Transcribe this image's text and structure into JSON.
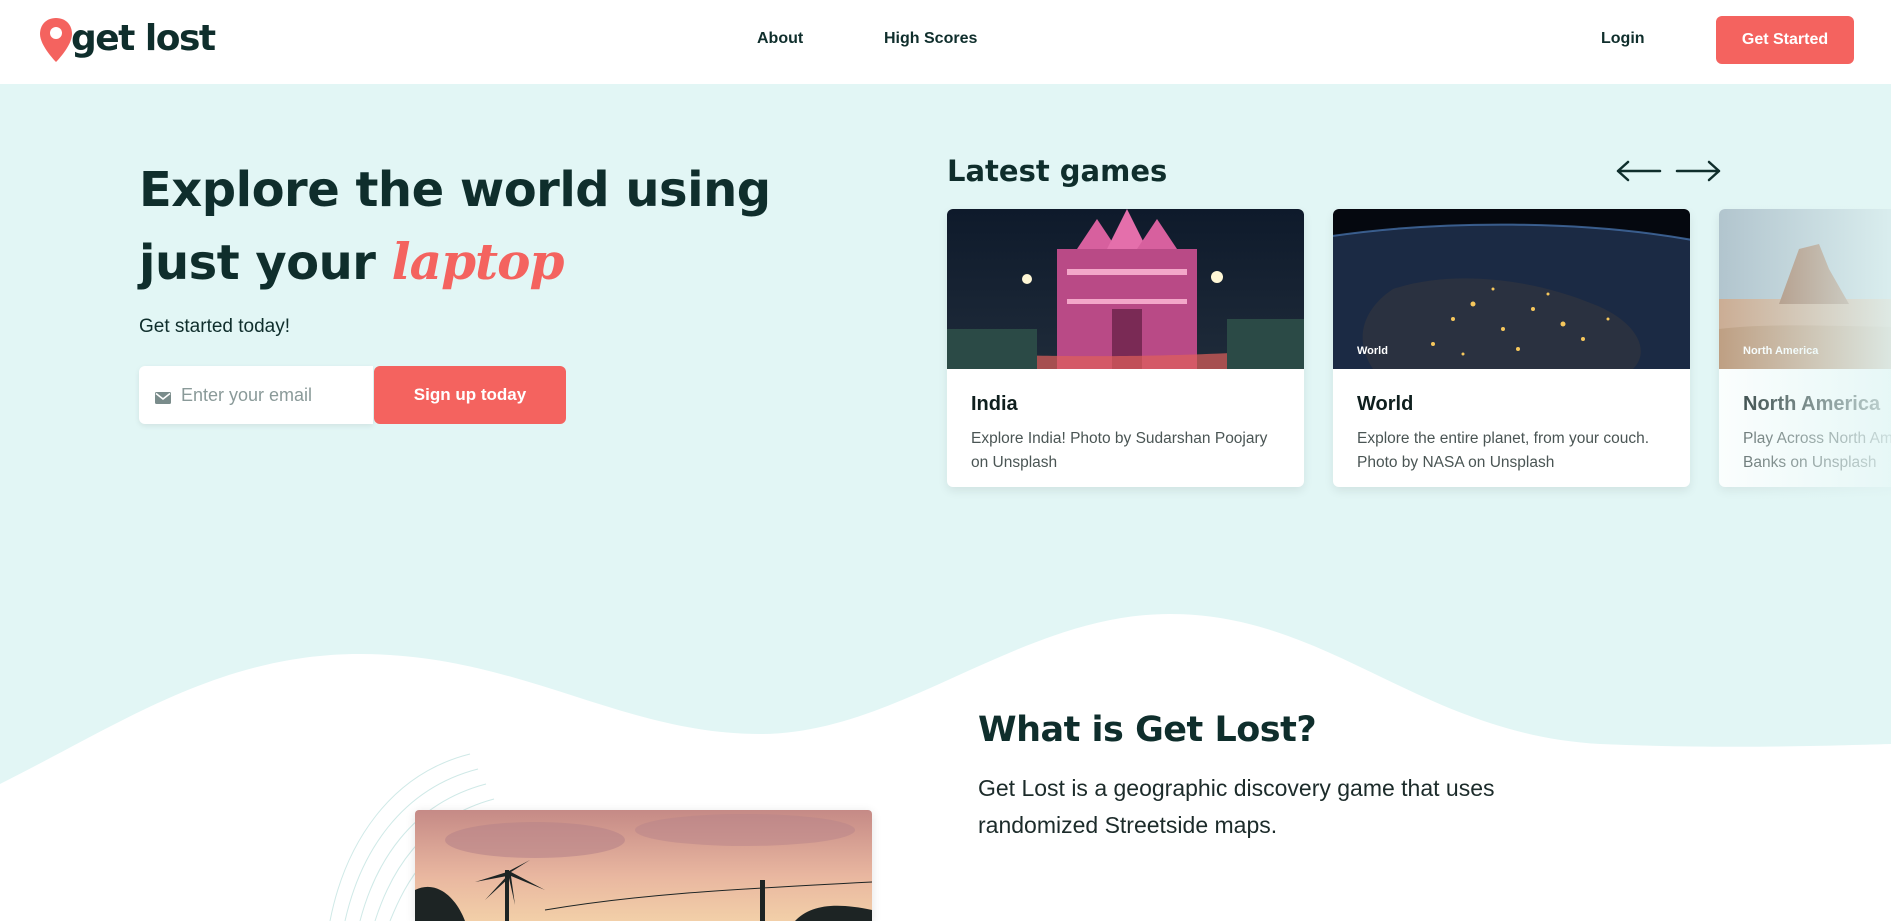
{
  "nav": {
    "logo_text": "get lost",
    "links": [
      {
        "label": "About"
      },
      {
        "label": "High Scores"
      }
    ],
    "login_label": "Login",
    "cta_label": "Get Started"
  },
  "hero": {
    "headline_main": "Explore the world using just your ",
    "headline_accent": "laptop",
    "subline": "Get started today!",
    "email_placeholder": "Enter your email",
    "signup_label": "Sign up today"
  },
  "latest": {
    "title": "Latest games",
    "games": [
      {
        "tag": "",
        "title": "India",
        "description": "Explore India! Photo by Sudarshan Poojary on Unsplash"
      },
      {
        "tag": "World",
        "title": "World",
        "description": "Explore the entire planet, from your couch. Photo by NASA on Unsplash"
      },
      {
        "tag": "North America",
        "title": "North America",
        "description": "Play Across North America. Photo by Frank Banks on Unsplash"
      }
    ]
  },
  "what_is": {
    "title": "What is Get Lost?",
    "description": "Get Lost is a geographic discovery game that uses randomized Streetside maps."
  },
  "colors": {
    "brand": "#f4635f",
    "dark": "#0f2e2c",
    "hero_bg": "#e2f6f5"
  },
  "icons": {
    "logo": "map-pin-icon",
    "email": "mail-icon",
    "prev": "arrow-left-icon",
    "next": "arrow-right-icon"
  }
}
